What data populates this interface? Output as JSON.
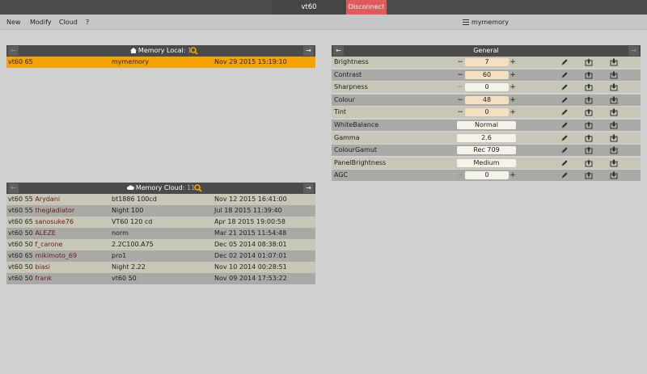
{
  "window": {
    "title": "vt60",
    "disconnect_label": "Disconnect"
  },
  "menu": {
    "items": [
      "New",
      "Modify",
      "Cloud",
      "?"
    ],
    "memory_name": "mymemory"
  },
  "local_panel": {
    "title": "Memory Local:",
    "count": "1",
    "rows": [
      {
        "model": "vt60 65",
        "name": "mymemory",
        "date": "Nov 29 2015  15:19:10"
      }
    ]
  },
  "cloud_panel": {
    "title": "Memory Cloud:",
    "count": "11",
    "rows": [
      {
        "model": "vt60 55",
        "user": "Arydani",
        "name": "bt1886 100cd",
        "date": "Nov 12 2015  16:41:00"
      },
      {
        "model": "vt60 55",
        "user": "thegladiator",
        "name": "Night 100",
        "date": "Jul 18 2015  11:39:40"
      },
      {
        "model": "vt60 65",
        "user": "sanosuke76",
        "name": "VT60 120 cd",
        "date": "Apr 18 2015  19:00:58"
      },
      {
        "model": "vt60 50",
        "user": "ALEZE",
        "name": "norm",
        "date": "Mar 21 2015  11:54:48"
      },
      {
        "model": "vt60 50",
        "user": "f_carone",
        "name": "2.2C100.A75",
        "date": "Dec 05 2014  08:38:01"
      },
      {
        "model": "vt60 65",
        "user": "mikimoto_69",
        "name": "pro1",
        "date": "Dec 02 2014  01:07:01"
      },
      {
        "model": "vt60 50",
        "user": "biasi",
        "name": "Night 2.22",
        "date": "Nov 10 2014  00:28:51"
      },
      {
        "model": "vt60 50",
        "user": "frank",
        "name": "vt60 50",
        "date": "Nov 09 2014  17:53:22"
      }
    ]
  },
  "general_panel": {
    "title": "General",
    "settings": [
      {
        "label": "Brightness",
        "kind": "num",
        "value": "7",
        "hl": true,
        "minus_dim": false
      },
      {
        "label": "Contrast",
        "kind": "num",
        "value": "60",
        "hl": true,
        "minus_dim": false
      },
      {
        "label": "Sharpness",
        "kind": "num",
        "value": "0",
        "hl": false,
        "minus_dim": true
      },
      {
        "label": "Colour",
        "kind": "num",
        "value": "48",
        "hl": true,
        "minus_dim": false
      },
      {
        "label": "Tint",
        "kind": "num",
        "value": "0",
        "hl": true,
        "minus_dim": false
      },
      {
        "label": "WhiteBalance",
        "kind": "sel",
        "value": "Normal"
      },
      {
        "label": "Gamma",
        "kind": "sel",
        "value": "2.6"
      },
      {
        "label": "ColourGamut",
        "kind": "sel",
        "value": "Rec 709"
      },
      {
        "label": "PanelBrightness",
        "kind": "sel",
        "value": "Medium"
      },
      {
        "label": "AGC",
        "kind": "num",
        "value": "0",
        "hl": false,
        "minus_dim": true
      }
    ]
  },
  "icons": {
    "arrow_left": "←",
    "arrow_right": "→",
    "minus": "−",
    "plus": "+"
  },
  "colors": {
    "accent": "#f5a300",
    "disconnect": "#e05a5a",
    "header": "#4a4a4a",
    "search": "#f5a300"
  }
}
